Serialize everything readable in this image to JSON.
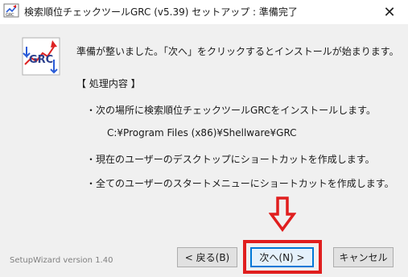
{
  "window": {
    "title": "検索順位チェックツールGRC (v5.39) セットアップ : 準備完了",
    "close_glyph": "✕"
  },
  "logo": {
    "text": "GRC"
  },
  "content": {
    "message": "準備が整いました。「次へ」をクリックするとインストールが始まります。",
    "section_title": "【 処理内容 】",
    "items": [
      "・次の場所に検索順位チェックツールGRCをインストールします。",
      "C:¥Program Files (x86)¥Shellware¥GRC",
      "・現在のユーザーのデスクトップにショートカットを作成します。",
      "・全てのユーザーのスタートメニューにショートカットを作成します。"
    ]
  },
  "footer": {
    "version_text": "SetupWizard version 1.40",
    "back_label": "< 戻る(B)",
    "next_label": "次へ(N) >",
    "cancel_label": "キャンセル"
  },
  "colors": {
    "annotation": "#e01e1e",
    "default_button_border": "#0078d7"
  }
}
